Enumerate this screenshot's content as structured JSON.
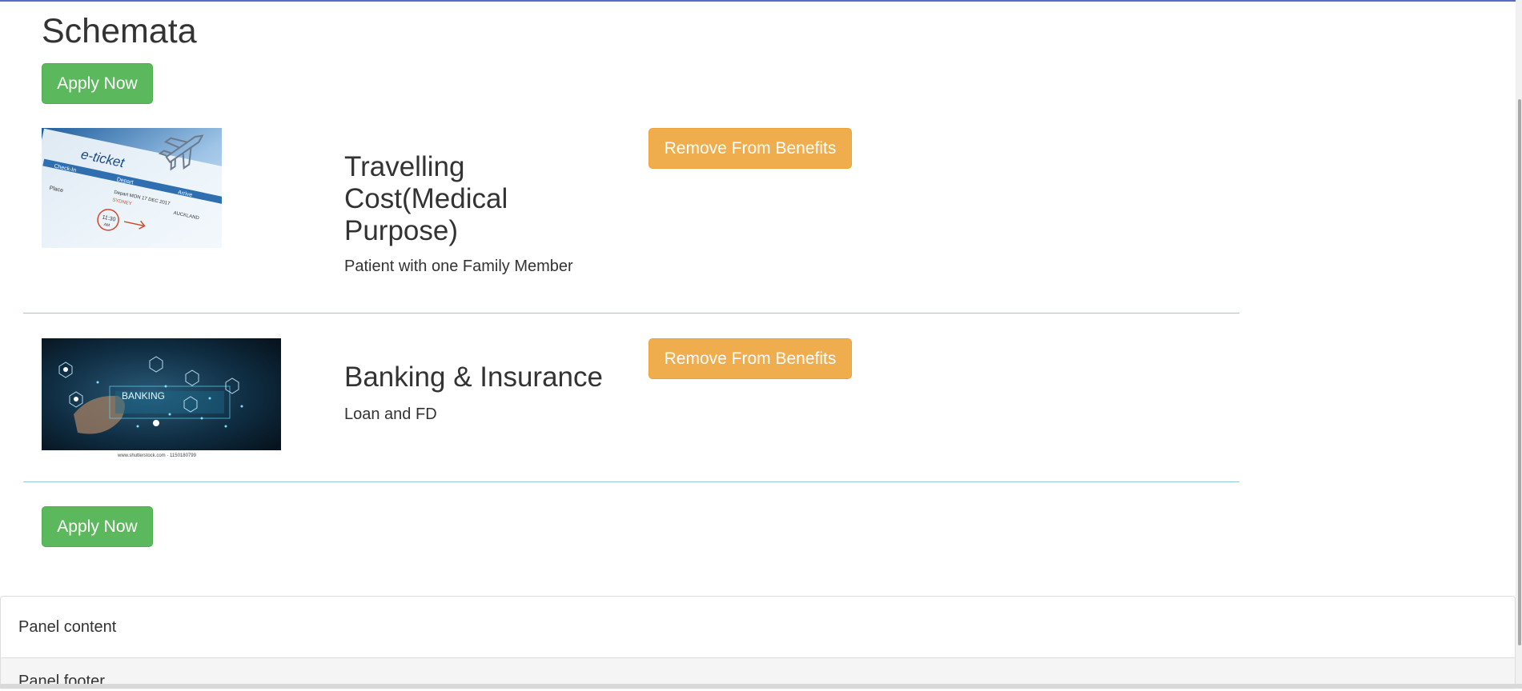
{
  "page": {
    "title": "Schemata",
    "apply_label": "Apply Now"
  },
  "items": [
    {
      "title": "Travelling Cost(Medical Purpose)",
      "description": "Patient with one Family Member",
      "button_label": "Remove From Benefits",
      "image": {
        "label": "e-ticket",
        "check_in": "Check-In",
        "depart": "Depart",
        "arrive": "Arrive",
        "city_from": "SYDNEY",
        "city_to": "AUCKLAND",
        "time": "11:30",
        "time_suffix": "AM",
        "date_text": "Depart MON 17 DEC 2017",
        "place": "Place"
      }
    },
    {
      "title": "Banking & Insurance",
      "description": "Loan and FD",
      "button_label": "Remove From Benefits",
      "image": {
        "label": "BANKING",
        "caption": "www.shutterstock.com · 1150180799"
      }
    }
  ],
  "panel": {
    "content": "Panel content",
    "footer": "Panel footer"
  },
  "colors": {
    "success": "#5cb85c",
    "warning": "#f0ad4e",
    "divider": "#8ec9dc"
  }
}
